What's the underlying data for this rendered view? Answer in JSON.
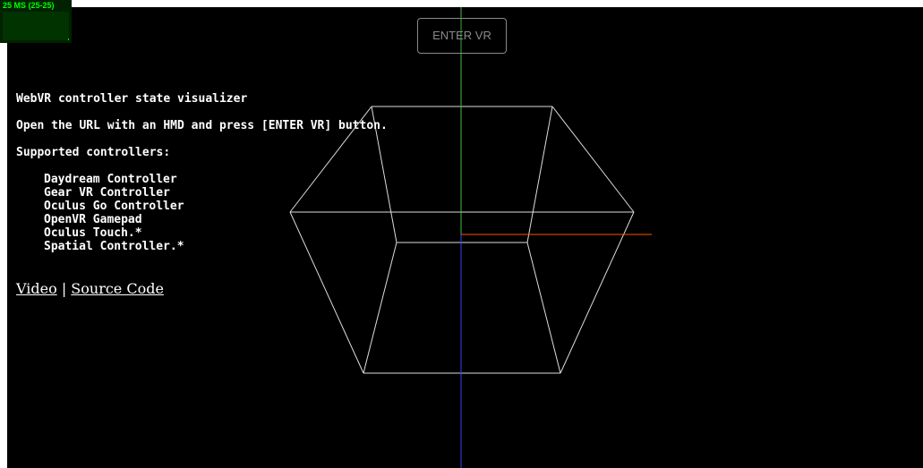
{
  "stats": {
    "label": "25 MS (25-25)",
    "graph_level": 0.06,
    "color": "#00ff00"
  },
  "enter_vr": {
    "label": "ENTER VR"
  },
  "info": {
    "title": "WebVR controller state visualizer",
    "instruction": "Open the URL with an HMD and press [ENTER VR] button.",
    "supported_heading": "Supported controllers:",
    "controllers": [
      "Daydream Controller",
      "Gear VR Controller",
      "Oculus Go Controller",
      "OpenVR Gamepad",
      "Oculus Touch.*",
      "Spatial Controller.*"
    ]
  },
  "links": {
    "video": "Video",
    "separator": " | ",
    "source_code": "Source Code"
  },
  "scene": {
    "background": "#000000",
    "box_color": "#ffffff",
    "axis_colors": {
      "x": "#ff5500",
      "y": "#44bb44",
      "z": "#3344ff"
    }
  }
}
